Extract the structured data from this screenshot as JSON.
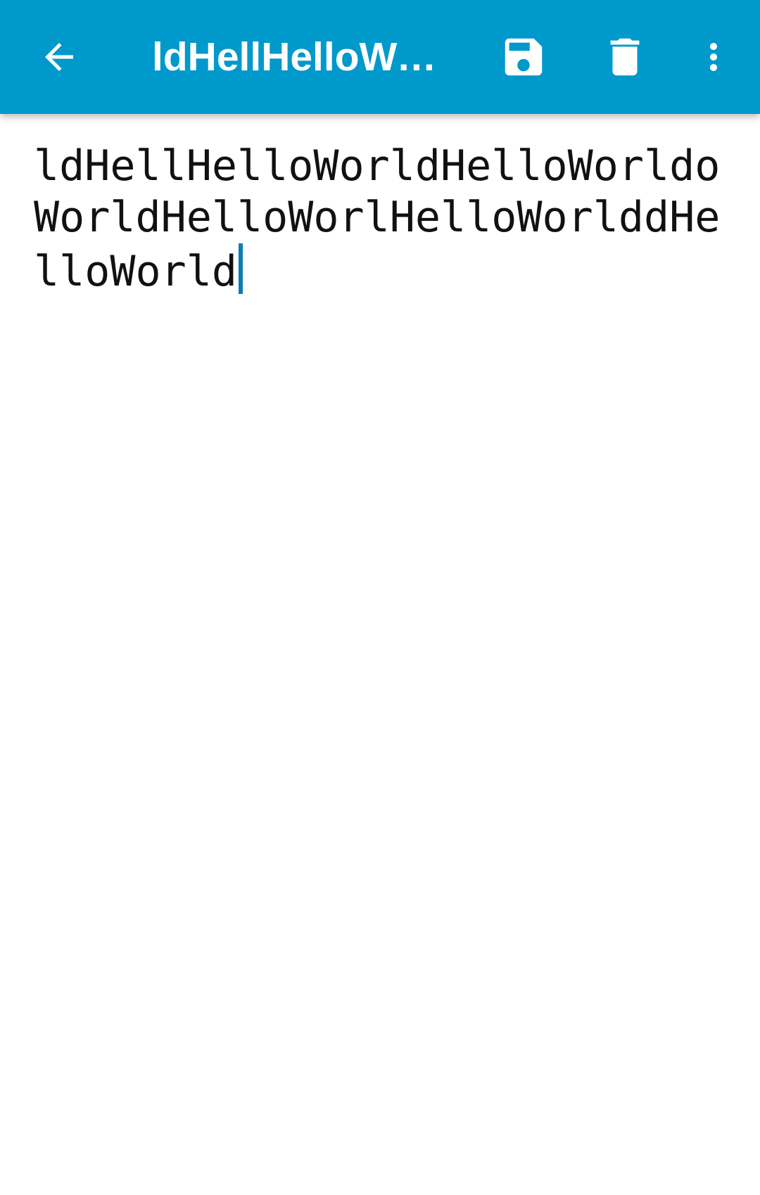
{
  "appbar": {
    "background_color": "#0099cc",
    "title": "ldHellHelloWorldHelloWorldoWorldHelloWorlHelloWorlddHelloWorld",
    "back_icon": "arrow-left-icon",
    "save_icon": "floppy-disk-icon",
    "delete_icon": "trash-icon",
    "overflow_icon": "more-vertical-icon"
  },
  "editor": {
    "text": "ldHellHelloWorldHelloWorldoWorldHelloWorlHelloWorlddHelloWorld",
    "cursor_color": "#0a7db3"
  }
}
